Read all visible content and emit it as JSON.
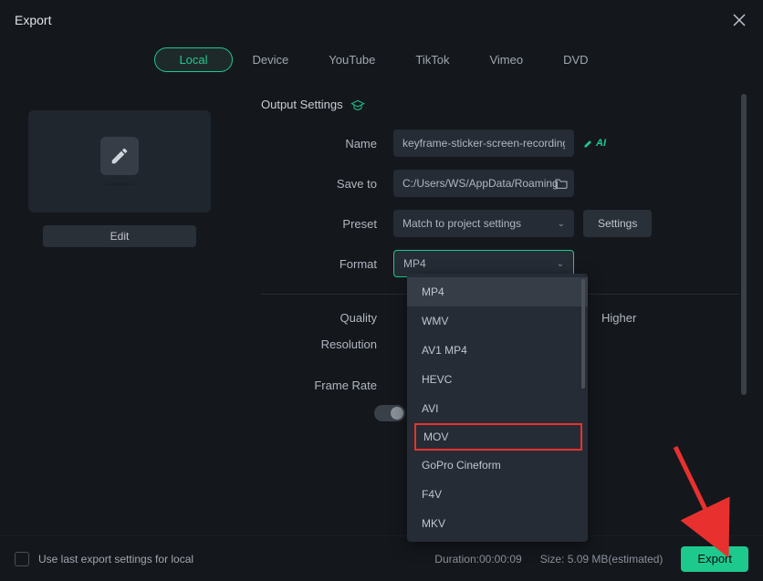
{
  "window": {
    "title": "Export"
  },
  "tabs": [
    {
      "label": "Local",
      "active": true
    },
    {
      "label": "Device",
      "active": false
    },
    {
      "label": "YouTube",
      "active": false
    },
    {
      "label": "TikTok",
      "active": false
    },
    {
      "label": "Vimeo",
      "active": false
    },
    {
      "label": "DVD",
      "active": false
    }
  ],
  "preview": {
    "edit_label": "Edit"
  },
  "settings": {
    "section_title": "Output Settings",
    "name_label": "Name",
    "name_value": "keyframe-sticker-screen-recording",
    "ai_label": "AI",
    "saveto_label": "Save to",
    "saveto_value": "C:/Users/WS/AppData/Roaming",
    "preset_label": "Preset",
    "preset_value": "Match to project settings",
    "settings_btn": "Settings",
    "format_label": "Format",
    "format_value": "MP4",
    "quality_label": "Quality",
    "quality_higher": "Higher",
    "resolution_label": "Resolution",
    "framerate_label": "Frame Rate"
  },
  "format_options": [
    {
      "label": "MP4",
      "hovered": true,
      "highlighted": false
    },
    {
      "label": "WMV",
      "hovered": false,
      "highlighted": false
    },
    {
      "label": "AV1 MP4",
      "hovered": false,
      "highlighted": false
    },
    {
      "label": "HEVC",
      "hovered": false,
      "highlighted": false
    },
    {
      "label": "AVI",
      "hovered": false,
      "highlighted": false
    },
    {
      "label": "MOV",
      "hovered": false,
      "highlighted": true
    },
    {
      "label": "GoPro Cineform",
      "hovered": false,
      "highlighted": false
    },
    {
      "label": "F4V",
      "hovered": false,
      "highlighted": false
    },
    {
      "label": "MKV",
      "hovered": false,
      "highlighted": false
    }
  ],
  "footer": {
    "checkbox_label": "Use last export settings for local",
    "duration_label": "Duration:00:00:09",
    "size_label": "Size: 5.09 MB(estimated)",
    "export_btn": "Export"
  }
}
